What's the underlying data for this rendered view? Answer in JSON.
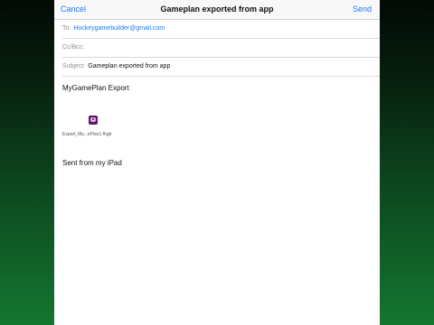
{
  "nav": {
    "cancel_label": "Cancel",
    "title": "Gameplan exported from app",
    "send_label": "Send"
  },
  "fields": {
    "to_label": "To:",
    "to_value": "Hockeygamebuilder@gmail.com",
    "ccbcc_label": "Cc/Bcc:",
    "subject_label": "Subject:",
    "subject_value": "Gameplan exported from app"
  },
  "body": {
    "heading": "MyGamePlan Export",
    "attachment_icon": "file-attachment-icon",
    "attachment_name": "Export_My...ePlan1.fhgb",
    "signature": "Sent from my iPad"
  },
  "colors": {
    "accent": "#1a7cf5",
    "background_top": "#020a04",
    "background_bottom": "#14762f",
    "attachment_icon": "#5a1563"
  }
}
